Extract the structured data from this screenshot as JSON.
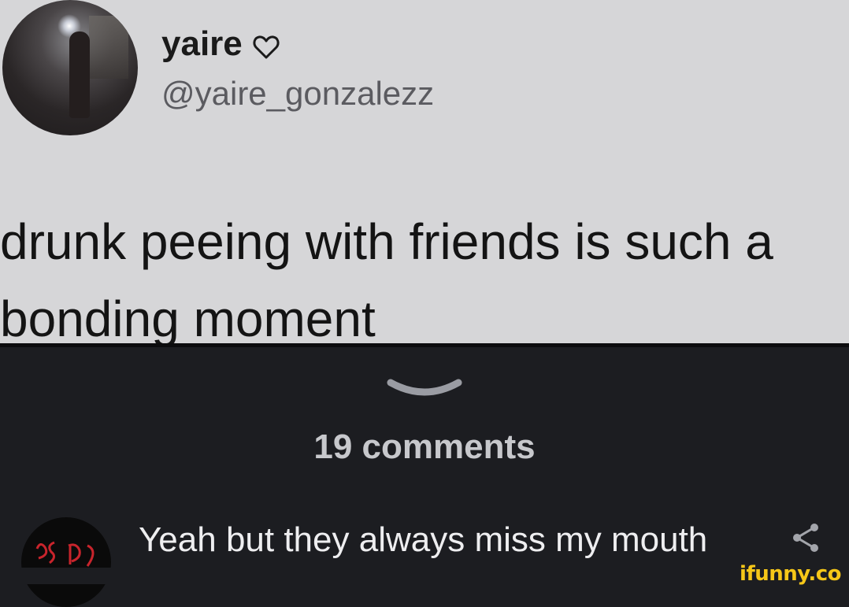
{
  "tweet": {
    "display_name": "yaire",
    "handle": "@yaire_gonzalezz",
    "text": "drunk peeing with friends is such a bonding moment"
  },
  "comments_header": "19 comments",
  "comment": {
    "avatar_logo_text": "PSD",
    "text": "Yeah but they always miss my mouth"
  },
  "watermark": "ifunny.co",
  "icons": {
    "heart": "heart-outline-icon",
    "chevron": "chevron-down-icon",
    "share": "share-icon"
  },
  "colors": {
    "tweet_bg": "#d6d6d8",
    "app_bg": "#1c1d21",
    "watermark": "#f6c718"
  }
}
